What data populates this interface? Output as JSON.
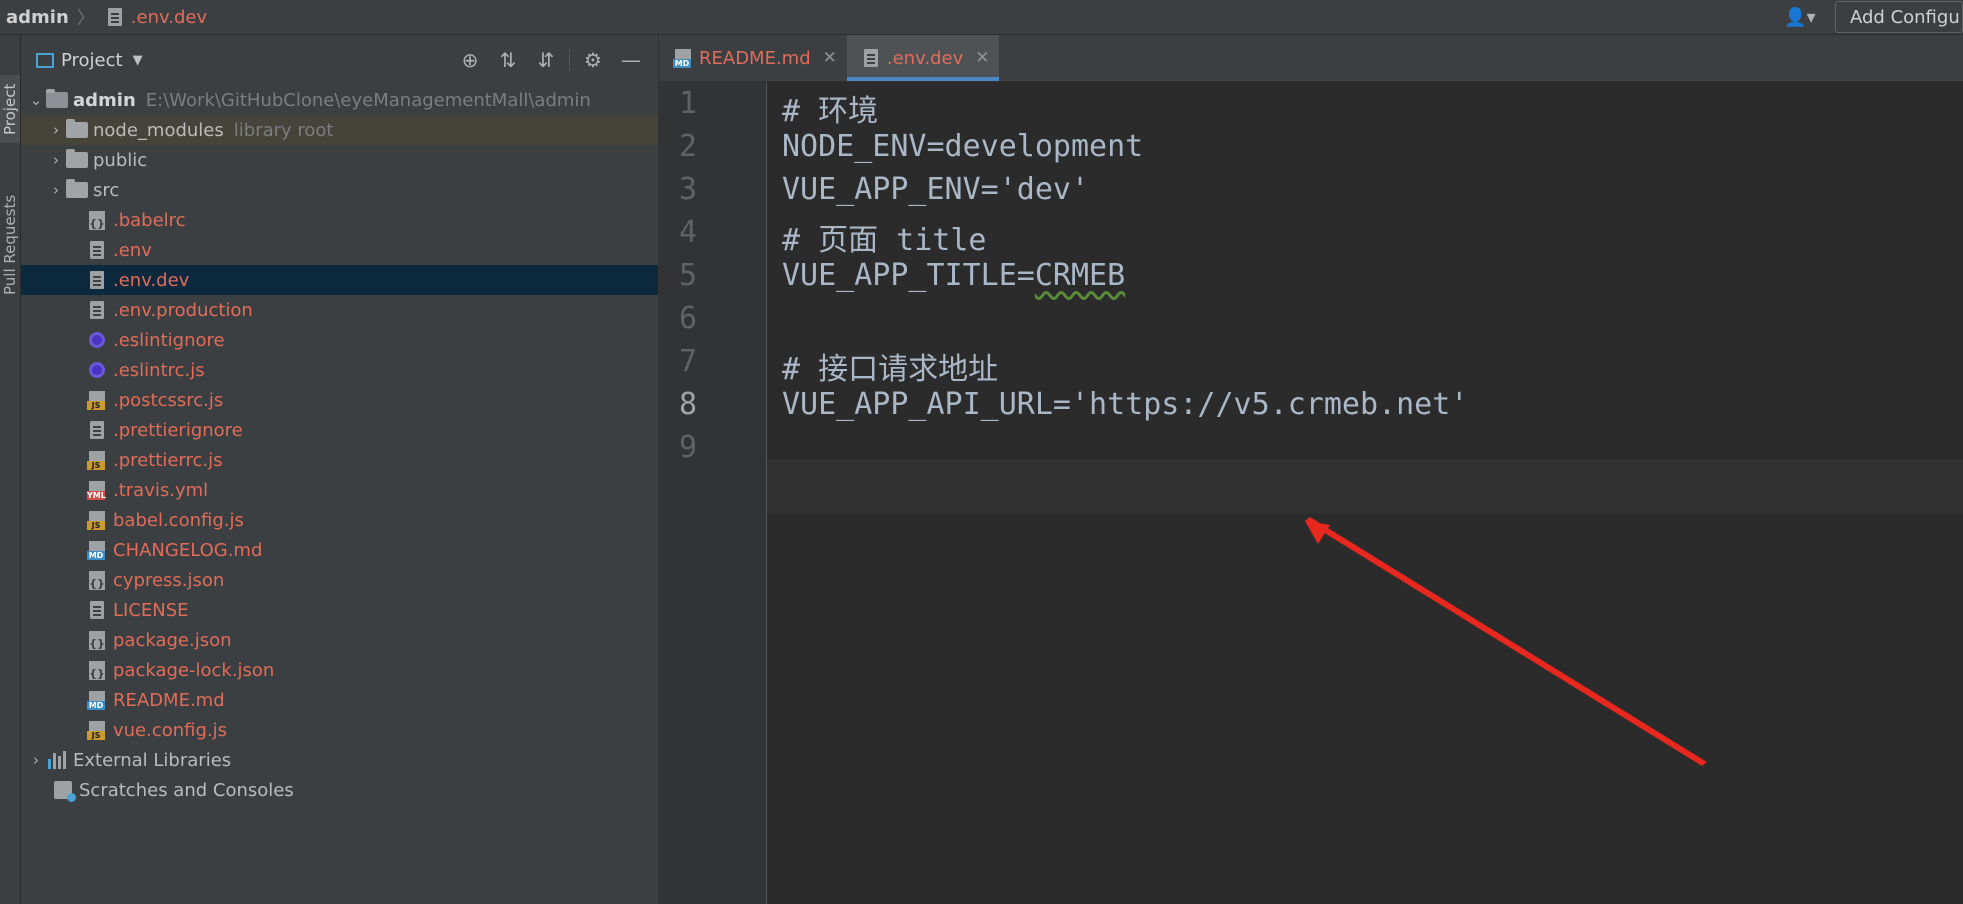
{
  "breadcrumb": {
    "root": "admin",
    "file": ".env.dev"
  },
  "toolbar": {
    "add_config_label": "Add Configu"
  },
  "side_tabs": {
    "project": "Project",
    "pull_requests": "Pull Requests"
  },
  "project_panel": {
    "title": "Project",
    "root": {
      "name": "admin",
      "path": "E:\\Work\\GitHubClone\\eyeManagementMall\\admin"
    },
    "folders": [
      {
        "name": "node_modules",
        "hint": "library root"
      },
      {
        "name": "public"
      },
      {
        "name": "src"
      }
    ],
    "files": [
      {
        "name": ".babelrc",
        "icon": "json-file-icon"
      },
      {
        "name": ".env",
        "icon": "text-file-icon"
      },
      {
        "name": ".env.dev",
        "icon": "text-file-icon"
      },
      {
        "name": ".env.production",
        "icon": "text-file-icon"
      },
      {
        "name": ".eslintignore",
        "icon": "eslint-icon"
      },
      {
        "name": ".eslintrc.js",
        "icon": "eslint-icon"
      },
      {
        "name": ".postcssrc.js",
        "icon": "js-file-icon"
      },
      {
        "name": ".prettierignore",
        "icon": "text-file-icon"
      },
      {
        "name": ".prettierrc.js",
        "icon": "js-file-icon"
      },
      {
        "name": ".travis.yml",
        "icon": "yml-file-icon"
      },
      {
        "name": "babel.config.js",
        "icon": "js-file-icon"
      },
      {
        "name": "CHANGELOG.md",
        "icon": "md-file-icon"
      },
      {
        "name": "cypress.json",
        "icon": "json-file-icon"
      },
      {
        "name": "LICENSE",
        "icon": "text-file-icon"
      },
      {
        "name": "package.json",
        "icon": "json-file-icon"
      },
      {
        "name": "package-lock.json",
        "icon": "json-file-icon"
      },
      {
        "name": "README.md",
        "icon": "md-file-icon"
      },
      {
        "name": "vue.config.js",
        "icon": "js-file-icon"
      }
    ],
    "external_libraries": "External Libraries",
    "scratches": "Scratches and Consoles"
  },
  "editor": {
    "tabs": [
      {
        "label": "README.md",
        "active": false
      },
      {
        "label": ".env.dev",
        "active": true
      }
    ],
    "current_line": 8,
    "lines": [
      {
        "num": "1",
        "text": "# 环境"
      },
      {
        "num": "2",
        "text": "NODE_ENV=development"
      },
      {
        "num": "3",
        "text": "VUE_APP_ENV='dev'"
      },
      {
        "num": "4",
        "text": "# 页面 title"
      },
      {
        "num": "5",
        "prefix": "VUE_APP_TITLE=",
        "marked": "CRMEB"
      },
      {
        "num": "6",
        "text": ""
      },
      {
        "num": "7",
        "text": "# 接口请求地址"
      },
      {
        "num": "8",
        "text": "VUE_APP_API_URL='https://v5.crmeb.net'"
      },
      {
        "num": "9",
        "text": ""
      }
    ]
  },
  "colors": {
    "annotation_arrow": "#e8281f",
    "modified_file": "#e06c5a",
    "selection": "#0d293e"
  }
}
